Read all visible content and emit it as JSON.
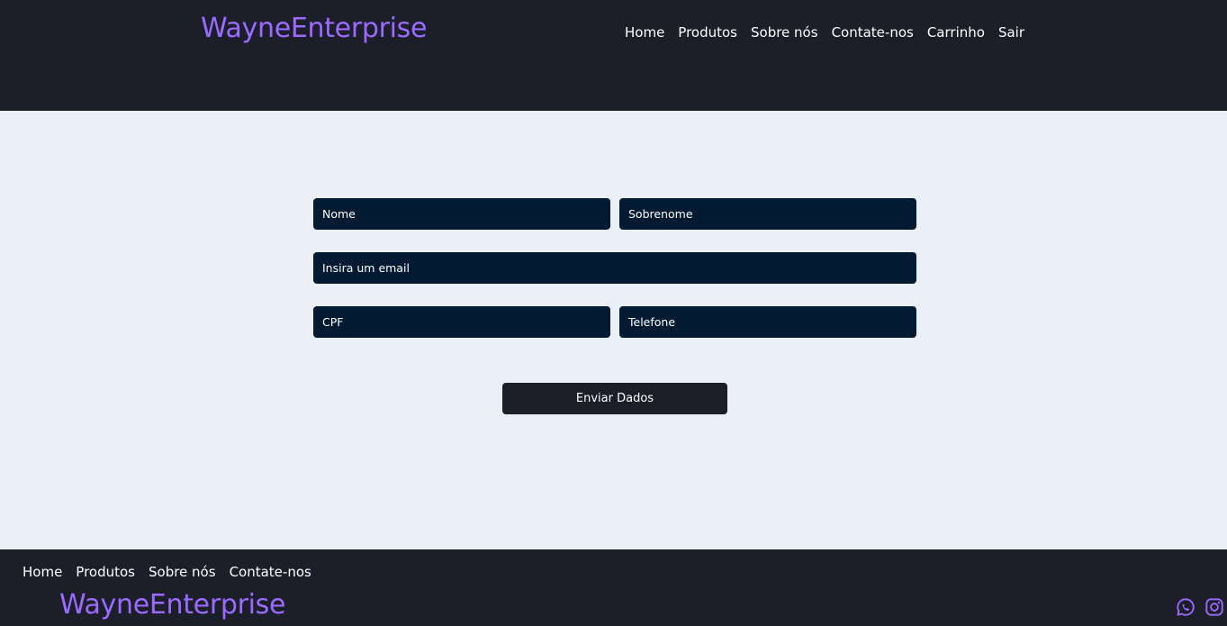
{
  "header": {
    "brand": "WayneEnterprise",
    "nav": [
      "Home",
      "Produtos",
      "Sobre nós",
      "Contate-nos",
      "Carrinho",
      "Sair"
    ]
  },
  "form": {
    "nome_placeholder": "Nome",
    "sobrenome_placeholder": "Sobrenome",
    "email_placeholder": "Insira um email",
    "cpf_placeholder": "CPF",
    "telefone_placeholder": "Telefone",
    "submit_label": "Enviar Dados"
  },
  "footer": {
    "nav": [
      "Home",
      "Produtos",
      "Sobre nós",
      "Contate-nos"
    ],
    "brand": "WayneEnterprise",
    "social_icons": [
      "whatsapp-icon",
      "instagram-icon"
    ]
  },
  "colors": {
    "brand": "#9b6bff",
    "header_bg": "#1c1f2a",
    "page_bg": "#eaeff8",
    "field_bg": "#031a33",
    "button_bg": "#1c1f2a",
    "text_light": "#ffffff"
  }
}
